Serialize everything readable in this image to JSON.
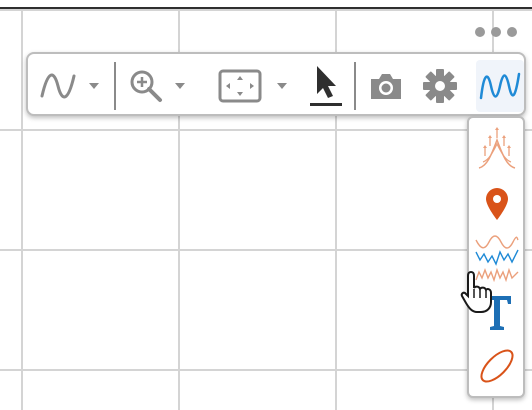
{
  "toolbar": {
    "more_icon": "more-horizontal-icon",
    "items": [
      {
        "name": "line-chart-icon",
        "has_dropdown": true
      },
      {
        "name": "zoom-in-icon",
        "has_dropdown": true
      },
      {
        "name": "fit-view-icon",
        "has_dropdown": true
      },
      {
        "name": "select-arrow-icon",
        "has_dropdown": false,
        "active": true
      },
      {
        "name": "camera-icon",
        "has_dropdown": false
      },
      {
        "name": "gear-icon",
        "has_dropdown": false
      },
      {
        "name": "waveform-icon",
        "has_dropdown": false,
        "selected": true
      }
    ]
  },
  "side_panel": {
    "items": [
      {
        "name": "peak-finder-icon"
      },
      {
        "name": "map-marker-icon"
      },
      {
        "name": "signal-compare-icon"
      },
      {
        "name": "text-annotation-icon"
      },
      {
        "name": "ellipse-icon"
      }
    ]
  },
  "colors": {
    "accent_blue": "#1f8ad6",
    "marker_orange": "#d95319",
    "pale_orange": "#eba07c",
    "icon_gray": "#8a8a8a",
    "dark_icon": "#2f2f2f",
    "text_blue": "#1d6fb5"
  },
  "cursor": "hand-pointer-icon"
}
